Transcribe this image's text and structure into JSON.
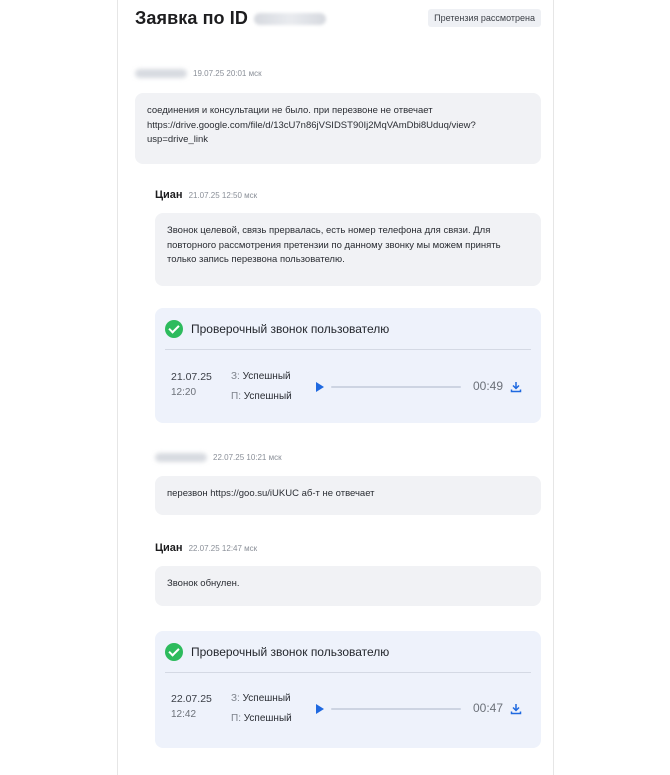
{
  "header": {
    "title": "Заявка по ID",
    "status_badge": "Претензия рассмотрена"
  },
  "messages": [
    {
      "author": "",
      "time": "19.07.25 20:01 мск",
      "text": "соединения и консультации не было. при перезвоне не отвечает https://drive.google.com/file/d/13cU7n86jVSIDST90Ij2MqVAmDbi8Uduq/view?usp=drive_link"
    },
    {
      "author": "Циан",
      "time": "21.07.25 12:50 мск",
      "text": "Звонок целевой, связь прервалась, есть номер телефона для связи. Для повторного рассмотрения претензии по данному звонку мы можем принять только запись перезвона пользователю."
    },
    {
      "author": "",
      "time": "22.07.25 10:21 мск",
      "text": "перезвон https://goo.su/iUKUC аб-т не отвечает"
    },
    {
      "author": "Циан",
      "time": "22.07.25 12:47 мск",
      "text": "Звонок обнулен."
    }
  ],
  "call_cards": [
    {
      "title": "Проверочный звонок пользователю",
      "date": "21.07.25",
      "time": "12:20",
      "status_z_key": "З:",
      "status_z": "Успешный",
      "status_p_key": "П:",
      "status_p": "Успешный",
      "duration": "00:49",
      "icons": [
        "check-circle-icon",
        "play-icon",
        "download-icon"
      ]
    },
    {
      "title": "Проверочный звонок пользователю",
      "date": "22.07.25",
      "time": "12:42",
      "status_z_key": "З:",
      "status_z": "Успешный",
      "status_p_key": "П:",
      "status_p": "Успешный",
      "duration": "00:47",
      "icons": [
        "check-circle-icon",
        "play-icon",
        "download-icon"
      ]
    }
  ],
  "colors": {
    "accent": "#1f69e0",
    "success": "#2dbb5d",
    "bubble": "#f1f2f5",
    "card": "#eef2fb"
  }
}
